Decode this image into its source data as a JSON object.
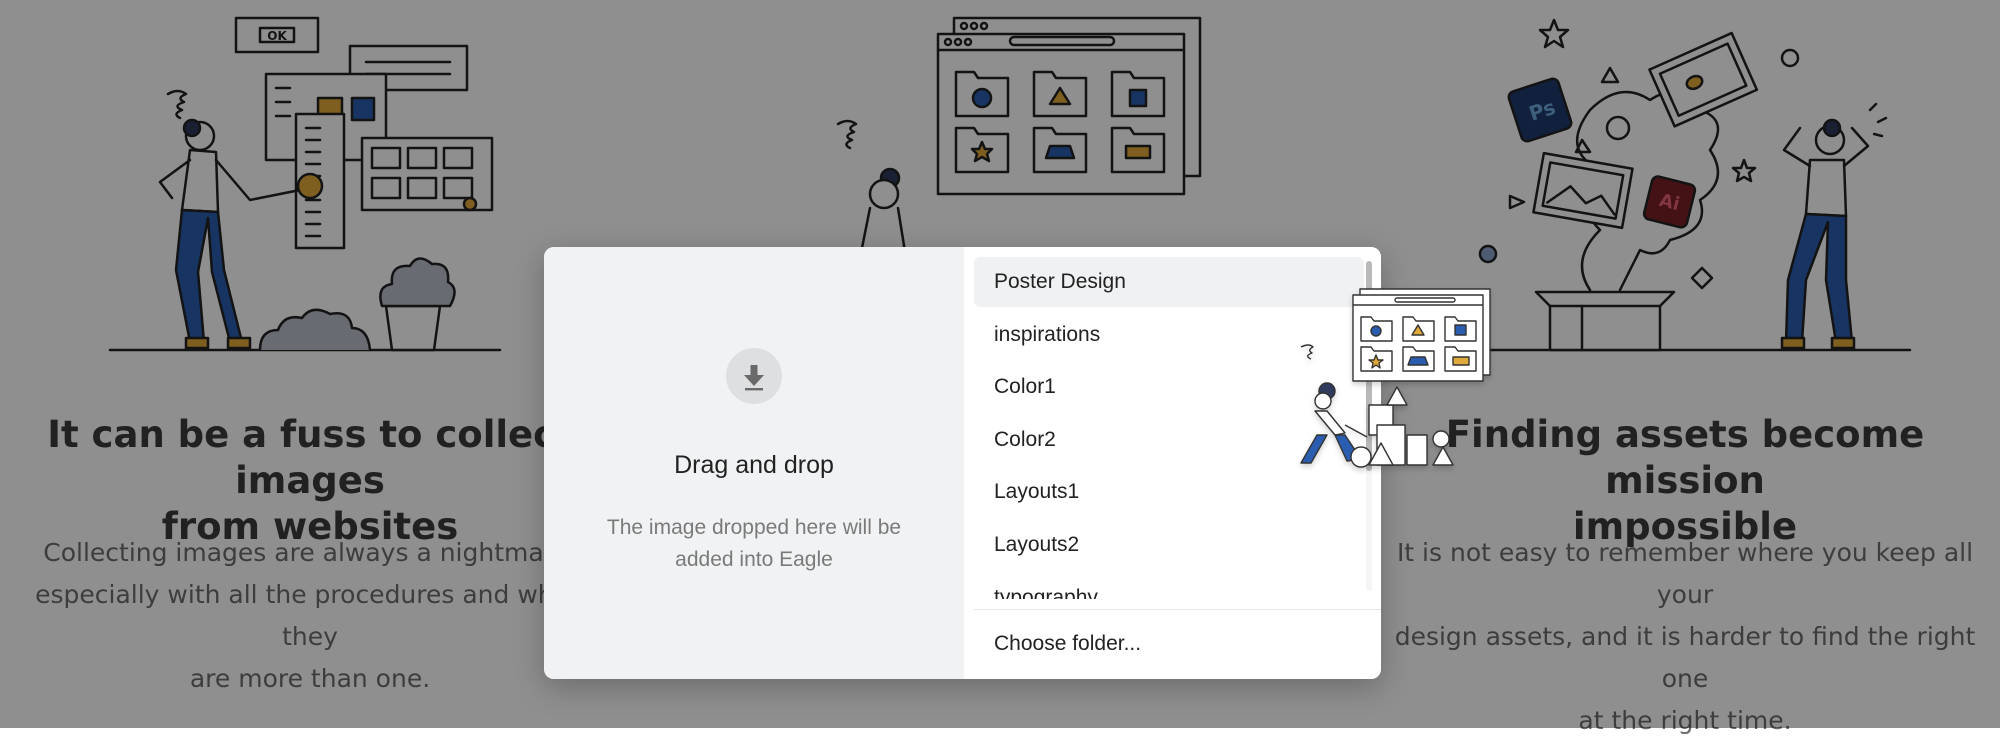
{
  "features": {
    "left": {
      "title_line1": "It can be a fuss to collect images",
      "title_line2": "from websites",
      "desc_line1": "Collecting images are always a nightmare,",
      "desc_line2": "especially with all the procedures and when they",
      "desc_line3": "are more than one."
    },
    "right": {
      "title_line1": "Finding assets become mission",
      "title_line2": "impossible",
      "desc_line1": "It is not easy to remember where you keep all your",
      "desc_line2": "design assets, and it is harder to find the right one",
      "desc_line3": "at the right time."
    }
  },
  "illustration_labels": {
    "ok_button": "OK",
    "ps_badge": "Ps",
    "ai_badge": "Ai"
  },
  "dialog": {
    "drop_title": "Drag and drop",
    "drop_desc": "The image dropped here will be added into Eagle",
    "drop_icon": "download-arrow-icon",
    "folders": [
      {
        "label": "Poster Design",
        "selected": true
      },
      {
        "label": "inspirations",
        "selected": false
      },
      {
        "label": "Color1",
        "selected": false
      },
      {
        "label": "Color2",
        "selected": false
      },
      {
        "label": "Layouts1",
        "selected": false
      },
      {
        "label": "Layouts2",
        "selected": false
      },
      {
        "label": "typography",
        "selected": false
      }
    ],
    "choose_folder_label": "Choose folder..."
  },
  "colors": {
    "accent_blue": "#2a5db0",
    "accent_gold": "#e0a93a",
    "dark_navy": "#2f3a5c",
    "ps_badge": "#1f3c6e",
    "ai_badge": "#7a1f25",
    "overlay": "rgba(0,0,0,0.44)"
  }
}
